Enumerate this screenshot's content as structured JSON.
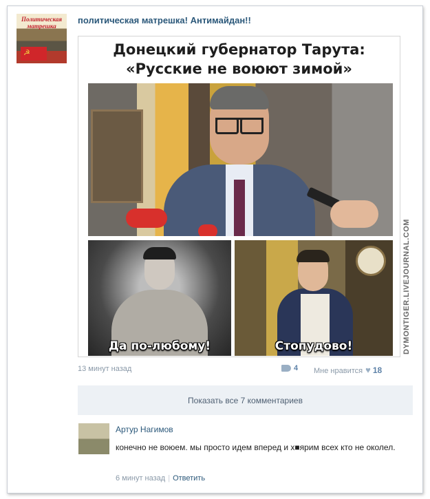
{
  "group": {
    "name": "политическая матрешка! Антимайдан!!",
    "avatar_text": "Политическая матрешка"
  },
  "post_image": {
    "headline_line1": "Донецкий губернатор Тарута:",
    "headline_line2": "«Русские не воюют зимой»",
    "caption_left": "Да по-любому!",
    "caption_right": "Стопудово!",
    "watermark": "DYMONTIGER.LIVEJOURNAL.COM"
  },
  "post_meta": {
    "timestamp": "13 минут назад",
    "share_count": "4",
    "like_label": "Мне нравится",
    "like_count": "18"
  },
  "show_comments_label": "Показать все 7 комментариев",
  "comment": {
    "author": "Артур Нагимов",
    "text": "конечно не воюем. мы просто идем вперед и х■ярим всех кто не околел.",
    "timestamp": "6 минут назад",
    "reply_label": "Ответить"
  },
  "colors": {
    "link": "#2b587a",
    "meta": "#8a99a8",
    "button_bg": "#edf1f5"
  }
}
